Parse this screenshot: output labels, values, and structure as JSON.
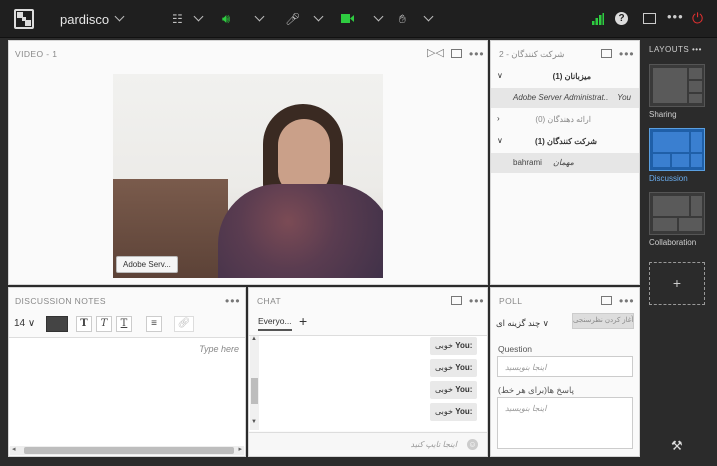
{
  "topbar": {
    "app_name": "pardisco",
    "icons": [
      "apps-grid-icon",
      "speaker-icon",
      "microphone-icon",
      "camera-icon",
      "raise-hand-icon",
      "signal-icon",
      "help-icon",
      "fullscreen-icon",
      "more-icon",
      "power-icon"
    ],
    "colors": {
      "speaker": "#2ecc40",
      "camera": "#2ecc40",
      "signal": "#2ecc40",
      "power": "#e03030"
    }
  },
  "video": {
    "title": "VIDEO",
    "count": "1",
    "speaker_label": "Adobe Serv..."
  },
  "attendees": {
    "title": "شرکت کنندگان",
    "count": "2",
    "groups": [
      {
        "label": "میزبانان (1)",
        "expanded": true
      },
      {
        "label": "ارائه دهندگان (0)",
        "expanded": false
      },
      {
        "label": "شرکت کنندگان (1)",
        "expanded": true
      }
    ],
    "host_row": {
      "name": "Adobe Server Administrat..",
      "tag": "You"
    },
    "participant_row": {
      "name": "bahrami",
      "tag": "مهمان"
    }
  },
  "notes": {
    "title": "DISCUSSION NOTES",
    "font_size": "14",
    "placeholder": "Type here"
  },
  "chat": {
    "title": "CHAT",
    "tab_label": "Everyo...",
    "messages": [
      {
        "sender": "You:",
        "text": "خوبی"
      },
      {
        "sender": "You:",
        "text": "خوبی"
      },
      {
        "sender": "You:",
        "text": "خوبی"
      },
      {
        "sender": "You:",
        "text": "خوبی"
      }
    ],
    "input_placeholder": "اینجا تایپ کنید"
  },
  "poll": {
    "title": "POLL",
    "type_label": "چند گزینه ای",
    "start_button": "آغاز کردن نظرسنجی",
    "question_label": "Question",
    "question_placeholder": "اینجا بنویسید",
    "answers_label": "پاسخ ها(برای هر خط)",
    "answers_placeholder": "اینجا بنویسید"
  },
  "layouts": {
    "title": "LAYOUTS",
    "items": [
      {
        "label": "Sharing",
        "active": false
      },
      {
        "label": "Discussion",
        "active": true
      },
      {
        "label": "Collaboration",
        "active": false
      }
    ],
    "add_label": "+",
    "active_color": "#6aaef0"
  }
}
